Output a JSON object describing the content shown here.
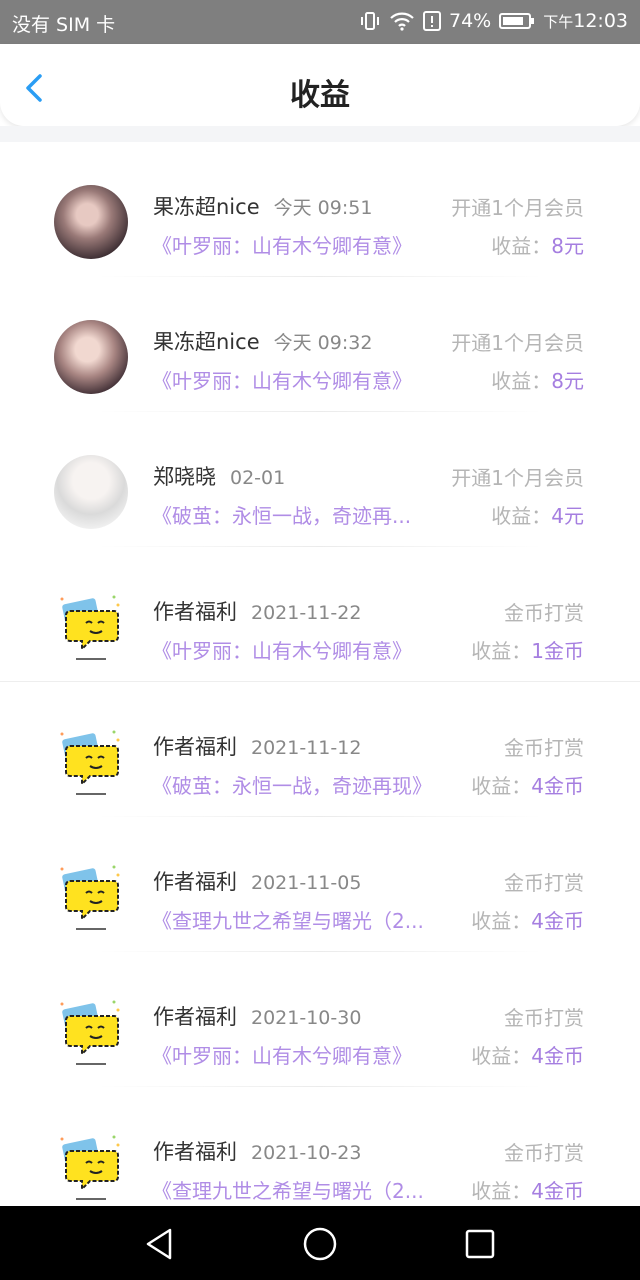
{
  "status_bar": {
    "carrier": "没有 SIM 卡",
    "battery": "74%",
    "time_prefix": "下午",
    "time": "12:03"
  },
  "header": {
    "title": "收益"
  },
  "earning_label": "收益：",
  "items": [
    {
      "name": "果冻超nice",
      "date": "今天 09:51",
      "type": "开通1个月会员",
      "book": "《叶罗丽：山有木兮卿有意》",
      "amount": "8元"
    },
    {
      "name": "果冻超nice",
      "date": "今天 09:32",
      "type": "开通1个月会员",
      "book": "《叶罗丽：山有木兮卿有意》",
      "amount": "8元"
    },
    {
      "name": "郑晓晓",
      "date": "02-01",
      "type": "开通1个月会员",
      "book": "《破茧：永恒一战，奇迹再...",
      "amount": "4元"
    },
    {
      "name": "作者福利",
      "date": "2021-11-22",
      "type": "金币打赏",
      "book": "《叶罗丽：山有木兮卿有意》",
      "amount": "1金币"
    },
    {
      "name": "作者福利",
      "date": "2021-11-12",
      "type": "金币打赏",
      "book": "《破茧：永恒一战，奇迹再现》",
      "amount": "4金币"
    },
    {
      "name": "作者福利",
      "date": "2021-11-05",
      "type": "金币打赏",
      "book": "《查理九世之希望与曙光（2...",
      "amount": "4金币"
    },
    {
      "name": "作者福利",
      "date": "2021-10-30",
      "type": "金币打赏",
      "book": "《叶罗丽：山有木兮卿有意》",
      "amount": "4金币"
    },
    {
      "name": "作者福利",
      "date": "2021-10-23",
      "type": "金币打赏",
      "book": "《查理九世之希望与曙光（2...",
      "amount": "4金币"
    }
  ]
}
